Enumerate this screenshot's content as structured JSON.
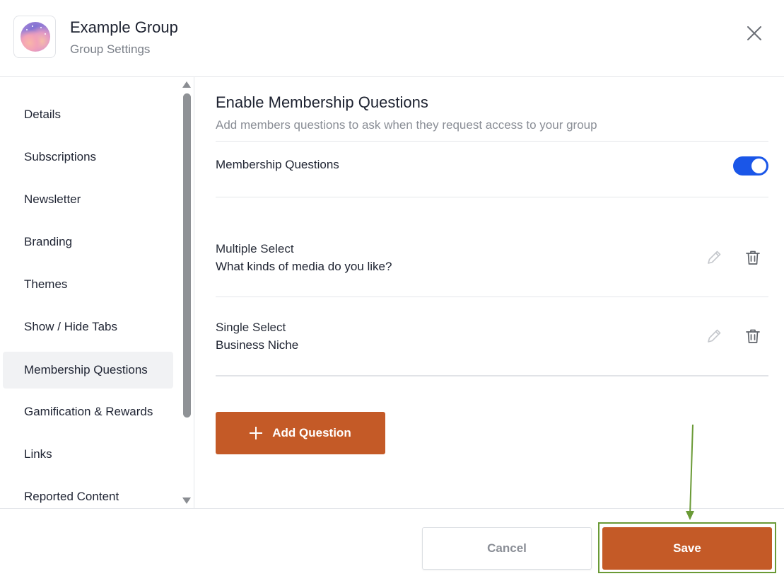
{
  "header": {
    "group_name": "Example Group",
    "subtitle": "Group Settings",
    "close_icon": "close-icon"
  },
  "sidebar": {
    "items": [
      {
        "label": "Details"
      },
      {
        "label": "Subscriptions"
      },
      {
        "label": "Newsletter"
      },
      {
        "label": "Branding"
      },
      {
        "label": "Themes"
      },
      {
        "label": "Show / Hide Tabs"
      },
      {
        "label": "Membership Questions",
        "active": true
      },
      {
        "label": "Gamification & Rewards"
      },
      {
        "label": "Links"
      },
      {
        "label": "Reported Content"
      }
    ]
  },
  "main": {
    "title": "Enable Membership Questions",
    "description": "Add members questions to ask when they request access to your group",
    "toggle_label": "Membership Questions",
    "toggle_on": true,
    "questions": [
      {
        "type": "Multiple Select",
        "text": "What kinds of media do you like?"
      },
      {
        "type": "Single Select",
        "text": "Business Niche"
      }
    ],
    "add_button_label": "Add Question"
  },
  "footer": {
    "cancel_label": "Cancel",
    "save_label": "Save"
  },
  "colors": {
    "accent": "#c45a27",
    "toggle": "#1a56e8",
    "highlight": "#6a9a36"
  }
}
